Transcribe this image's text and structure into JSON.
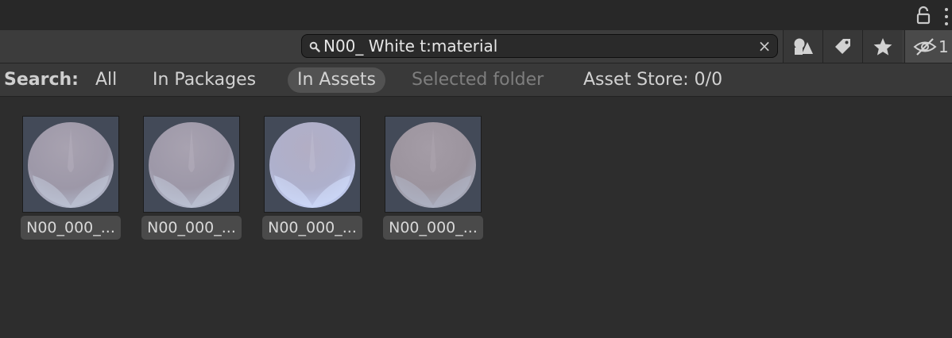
{
  "header": {
    "icons": [
      "lock-icon",
      "kebab-menu-icon"
    ]
  },
  "toolbar": {
    "search_value": "N00_ White t:material",
    "clear_symbol": "×",
    "buttons": [
      "search-by-type-icon",
      "search-by-label-icon",
      "favorite-star-icon",
      "hidden-packages-icon"
    ],
    "hidden_packages_count": "1"
  },
  "scope_bar": {
    "label": "Search:",
    "options": [
      "All",
      "In Packages",
      "In Assets",
      "Selected folder",
      "Asset Store: 0/0"
    ],
    "selected": "In Assets",
    "disabled": "Selected folder"
  },
  "assets": [
    {
      "label": "N00_000_..."
    },
    {
      "label": "N00_000_..."
    },
    {
      "label": "N00_000_..."
    },
    {
      "label": "N00_000_..."
    }
  ],
  "colors": {
    "window_bg": "#2d2d2d",
    "toolbar_bg": "#3c3c3c",
    "scope_selected_bg": "#525252",
    "thumb_bg": "#434a58"
  }
}
